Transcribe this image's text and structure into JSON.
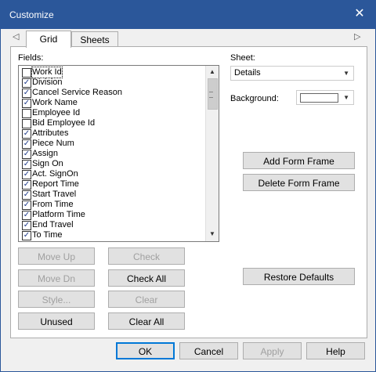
{
  "window": {
    "title": "Customize",
    "close_glyph": "✕"
  },
  "tabs": [
    {
      "label": "Grid"
    },
    {
      "label": "Sheets"
    }
  ],
  "tab_arrows": {
    "left": "◁",
    "right": "▷"
  },
  "fields_label": "Fields:",
  "fields": [
    {
      "label": "Work Id",
      "checked": false
    },
    {
      "label": "Division",
      "checked": true
    },
    {
      "label": "Cancel Service Reason",
      "checked": true
    },
    {
      "label": "Work Name",
      "checked": true
    },
    {
      "label": "Employee Id",
      "checked": false
    },
    {
      "label": "Bid Employee Id",
      "checked": false
    },
    {
      "label": "Attributes",
      "checked": true
    },
    {
      "label": "Piece Num",
      "checked": true
    },
    {
      "label": "Assign",
      "checked": true
    },
    {
      "label": "Sign On",
      "checked": true
    },
    {
      "label": "Act. SignOn",
      "checked": true
    },
    {
      "label": "Report Time",
      "checked": true
    },
    {
      "label": "Start Travel",
      "checked": true
    },
    {
      "label": "From Time",
      "checked": true
    },
    {
      "label": "Platform Time",
      "checked": true
    },
    {
      "label": "End Travel",
      "checked": true
    },
    {
      "label": "To Time",
      "checked": true
    }
  ],
  "check_glyph": "✓",
  "list_buttons": {
    "move_up": "Move Up",
    "check": "Check",
    "move_dn": "Move Dn",
    "check_all": "Check All",
    "style": "Style...",
    "clear": "Clear",
    "unused": "Unused",
    "clear_all": "Clear All"
  },
  "sheet_label": "Sheet:",
  "sheet_value": "Details",
  "background_label": "Background:",
  "side_buttons": {
    "add_form_frame": "Add Form Frame",
    "delete_form_frame": "Delete Form Frame",
    "restore_defaults": "Restore Defaults"
  },
  "footer": {
    "ok": "OK",
    "cancel": "Cancel",
    "apply": "Apply",
    "help": "Help"
  }
}
